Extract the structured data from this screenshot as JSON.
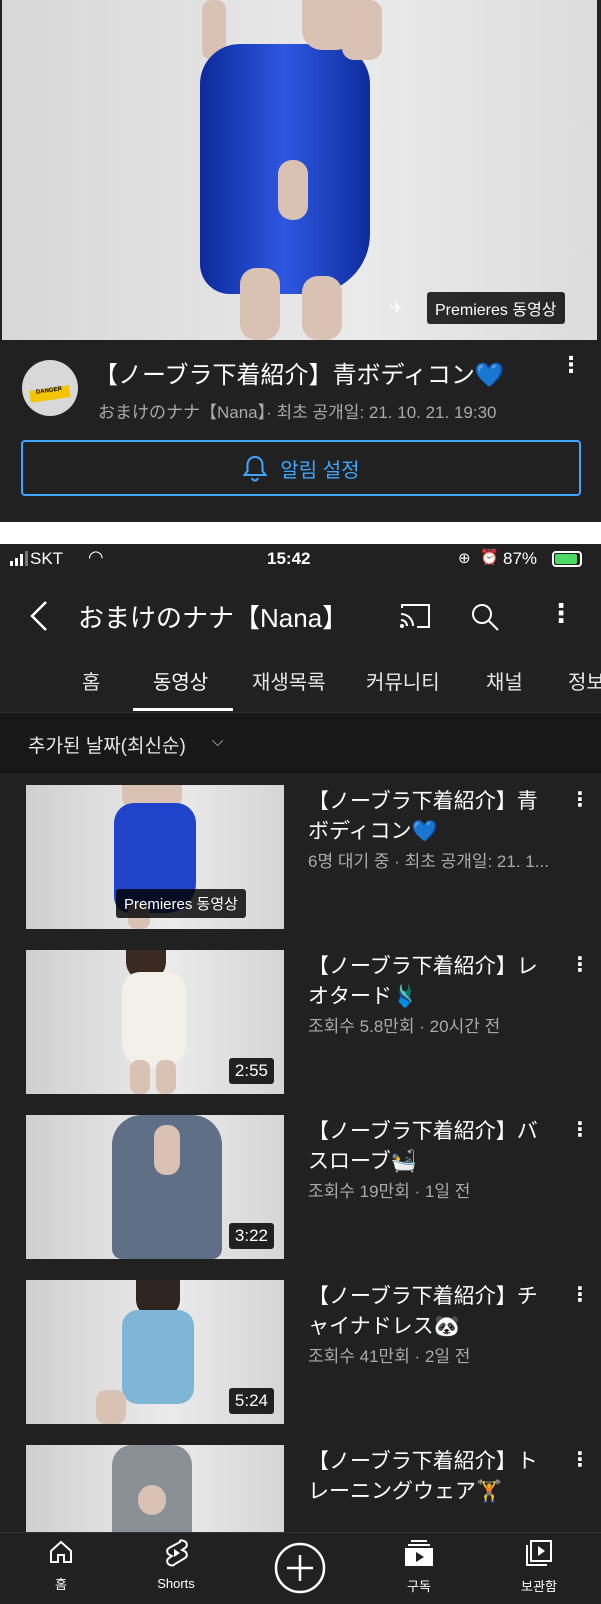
{
  "hero": {
    "badge": "Premieres 동영상",
    "title": "【ノーブラ下着紹介】青ボディコン💙",
    "meta": "おまけのナナ【Nana】· 최초 공개일: 21. 10. 21. 19:30",
    "notify_label": "알림 설정",
    "avatar_text": "DANGER"
  },
  "status_bar": {
    "carrier": "SKT",
    "time": "15:42",
    "battery": "87%"
  },
  "header": {
    "channel_name": "おまけのナナ【Nana】"
  },
  "tabs": [
    {
      "label": "홈"
    },
    {
      "label": "동영상"
    },
    {
      "label": "재생목록"
    },
    {
      "label": "커뮤니티"
    },
    {
      "label": "채널"
    },
    {
      "label": "정보"
    }
  ],
  "sort": {
    "label": "추가된 날짜(최신순)"
  },
  "videos": [
    {
      "title": "【ノーブラ下着紹介】青ボディコン💙",
      "meta": "6명 대기 중 · 최초 공개일: 21. 1...",
      "badge": "Premieres 동영상",
      "color": "#1f44c9"
    },
    {
      "title": "【ノーブラ下着紹介】レオタード🩱",
      "meta": "조회수 5.8만회 · 20시간 전",
      "badge": "2:55",
      "color": "#f3f0ea"
    },
    {
      "title": "【ノーブラ下着紹介】バスローブ🛀",
      "meta": "조회수 19만회 · 1일 전",
      "badge": "3:22",
      "color": "#5f6f86"
    },
    {
      "title": "【ノーブラ下着紹介】チャイナドレス🐼",
      "meta": "조회수 41만회 · 2일 전",
      "badge": "5:24",
      "color": "#7fb6d8"
    },
    {
      "title": "【ノーブラ下着紹介】トレーニングウェア🏋",
      "meta": "",
      "badge": "",
      "color": "#8b8f96"
    }
  ],
  "bottom_nav": [
    {
      "label": "홈",
      "icon": "home-icon"
    },
    {
      "label": "Shorts",
      "icon": "shorts-icon"
    },
    {
      "label": "",
      "icon": "create-icon"
    },
    {
      "label": "구독",
      "icon": "subscriptions-icon"
    },
    {
      "label": "보관함",
      "icon": "library-icon"
    }
  ]
}
